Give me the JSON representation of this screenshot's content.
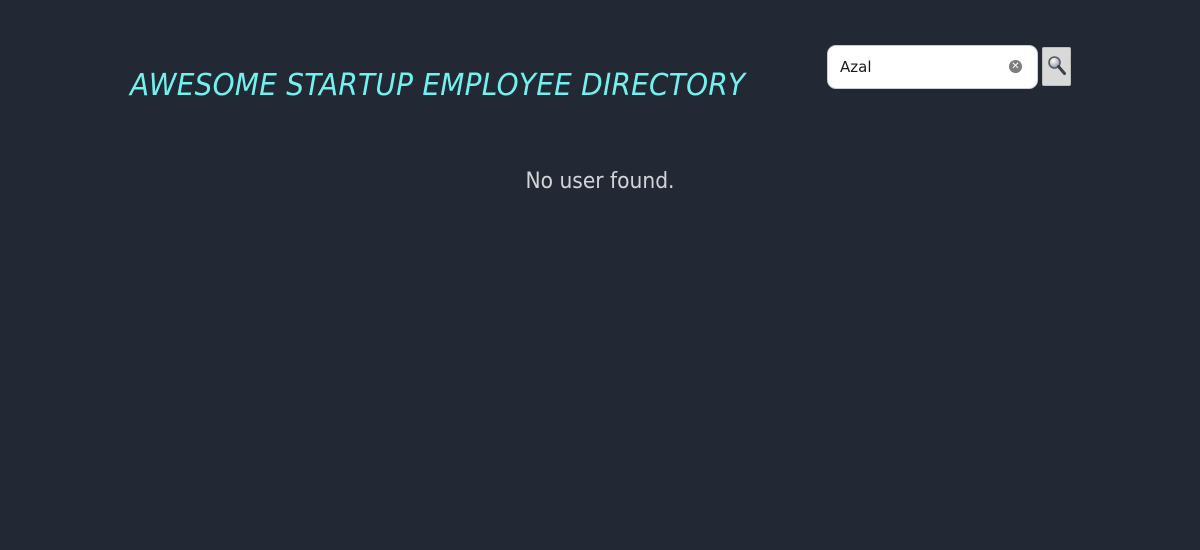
{
  "header": {
    "title": "AWESOME STARTUP EMPLOYEE DIRECTORY"
  },
  "search": {
    "value": "Azal",
    "clear_icon": "clear-icon",
    "button_icon": "magnifying-glass-icon"
  },
  "results": {
    "empty_message": "No user found."
  },
  "colors": {
    "background": "#222834",
    "title": "#72f2ee",
    "message": "#d3d4d8"
  }
}
